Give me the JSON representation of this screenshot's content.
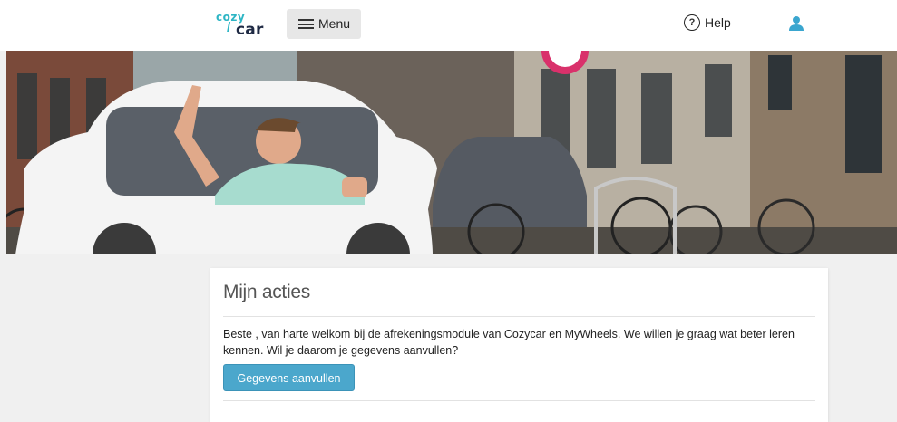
{
  "header": {
    "logo_top": "cozy",
    "logo_bottom": "car",
    "menu_label": "Menu",
    "help_label": "Help",
    "brand_color": "#2db5c4"
  },
  "hero": {
    "image": "banner-photo-man-waving-behind-car-cutout"
  },
  "actions": {
    "title": "Mijn acties",
    "message": "Beste , van harte welkom bij de afrekeningsmodule van Cozycar en MyWheels. We willen je graag wat beter leren kennen. Wil je daarom je gegevens aanvullen?",
    "button_label": "Gegevens aanvullen",
    "button_color": "#4ba7cc"
  }
}
